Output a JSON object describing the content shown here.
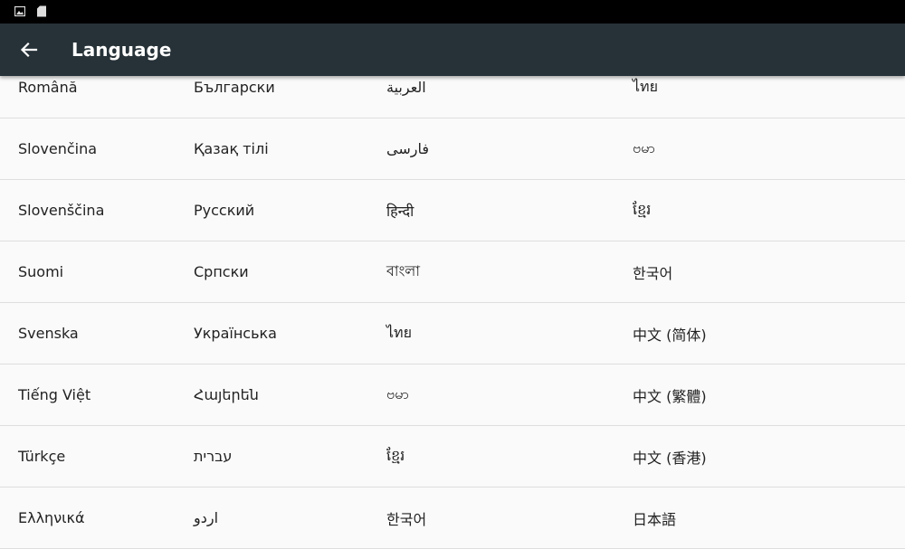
{
  "app_bar": {
    "title": "Language",
    "back_icon": "arrow-left-icon"
  },
  "colors": {
    "app_bar": "#263238",
    "status_bar": "#000000",
    "background": "#fafafa",
    "text": "#222222"
  },
  "status_bar": {
    "icons": [
      "image-icon",
      "sd-card-icon"
    ]
  },
  "languages": [
    [
      "Română",
      "Български",
      "العربية",
      "ไทย"
    ],
    [
      "Slovenčina",
      "Қазақ тілі",
      "فارسی",
      "ဗမာ"
    ],
    [
      "Slovenščina",
      "Русский",
      "हिन्दी",
      "ខ្មែរ"
    ],
    [
      "Suomi",
      "Српски",
      "বাংলা",
      "한국어"
    ],
    [
      "Svenska",
      "Українська",
      "ไทย",
      "中文 (简体)"
    ],
    [
      "Tiếng Việt",
      "Հայերեն",
      "ဗမာ",
      "中文 (繁體)"
    ],
    [
      "Türkçe",
      "עברית",
      "ខ្មែរ",
      "中文 (香港)"
    ],
    [
      "Ελληνικά",
      "اردو",
      "한국어",
      "日本語"
    ]
  ]
}
